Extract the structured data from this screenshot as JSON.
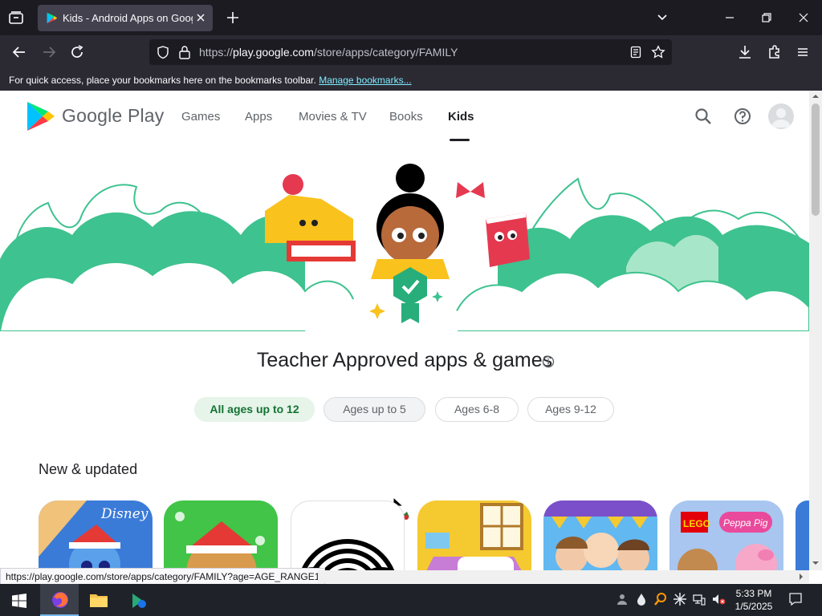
{
  "browser": {
    "tab": {
      "title": "Kids - Android Apps on Google Play"
    },
    "url": {
      "prefix": "https://",
      "host": "play.google.com",
      "path": "/store/apps/category/FAMILY"
    },
    "bookmarks_bar": {
      "message": "For quick access, place your bookmarks here on the bookmarks toolbar.",
      "link": "Manage bookmarks..."
    },
    "status_link": "https://play.google.com/store/apps/category/FAMILY?age=AGE_RANGE1"
  },
  "header": {
    "brand": "Google Play",
    "nav": [
      {
        "label": "Games"
      },
      {
        "label": "Apps"
      },
      {
        "label": "Movies & TV"
      },
      {
        "label": "Books"
      },
      {
        "label": "Kids",
        "active": true
      }
    ]
  },
  "hero": {
    "title": "Teacher Approved apps & games"
  },
  "age_filters": [
    {
      "label": "All ages up to 12",
      "selected": true
    },
    {
      "label": "Ages up to 5"
    },
    {
      "label": "Ages 6-8"
    },
    {
      "label": "Ages 9-12"
    }
  ],
  "section": {
    "title": "New & updated",
    "apps": [
      {
        "icon_text": "Disney",
        "color": "#3b7bd8"
      },
      {
        "icon_text": "",
        "color": "#41c447"
      },
      {
        "icon_text": "",
        "color": "#ffffff"
      },
      {
        "icon_text": "",
        "color": "#f5c930"
      },
      {
        "icon_text": "",
        "color": "#62b8f0"
      },
      {
        "icon_text": "LEGO",
        "icon_text2": "Peppa Pig",
        "color": "#a8c6ef"
      }
    ]
  },
  "taskbar": {
    "time": "5:33 PM",
    "date": "1/5/2025"
  },
  "colors": {
    "chrome_dark": "#1c1b22",
    "chrome_mid": "#2b2a33",
    "hero_green": "#3ec28f",
    "chip_selected_bg": "#e6f4ea"
  }
}
